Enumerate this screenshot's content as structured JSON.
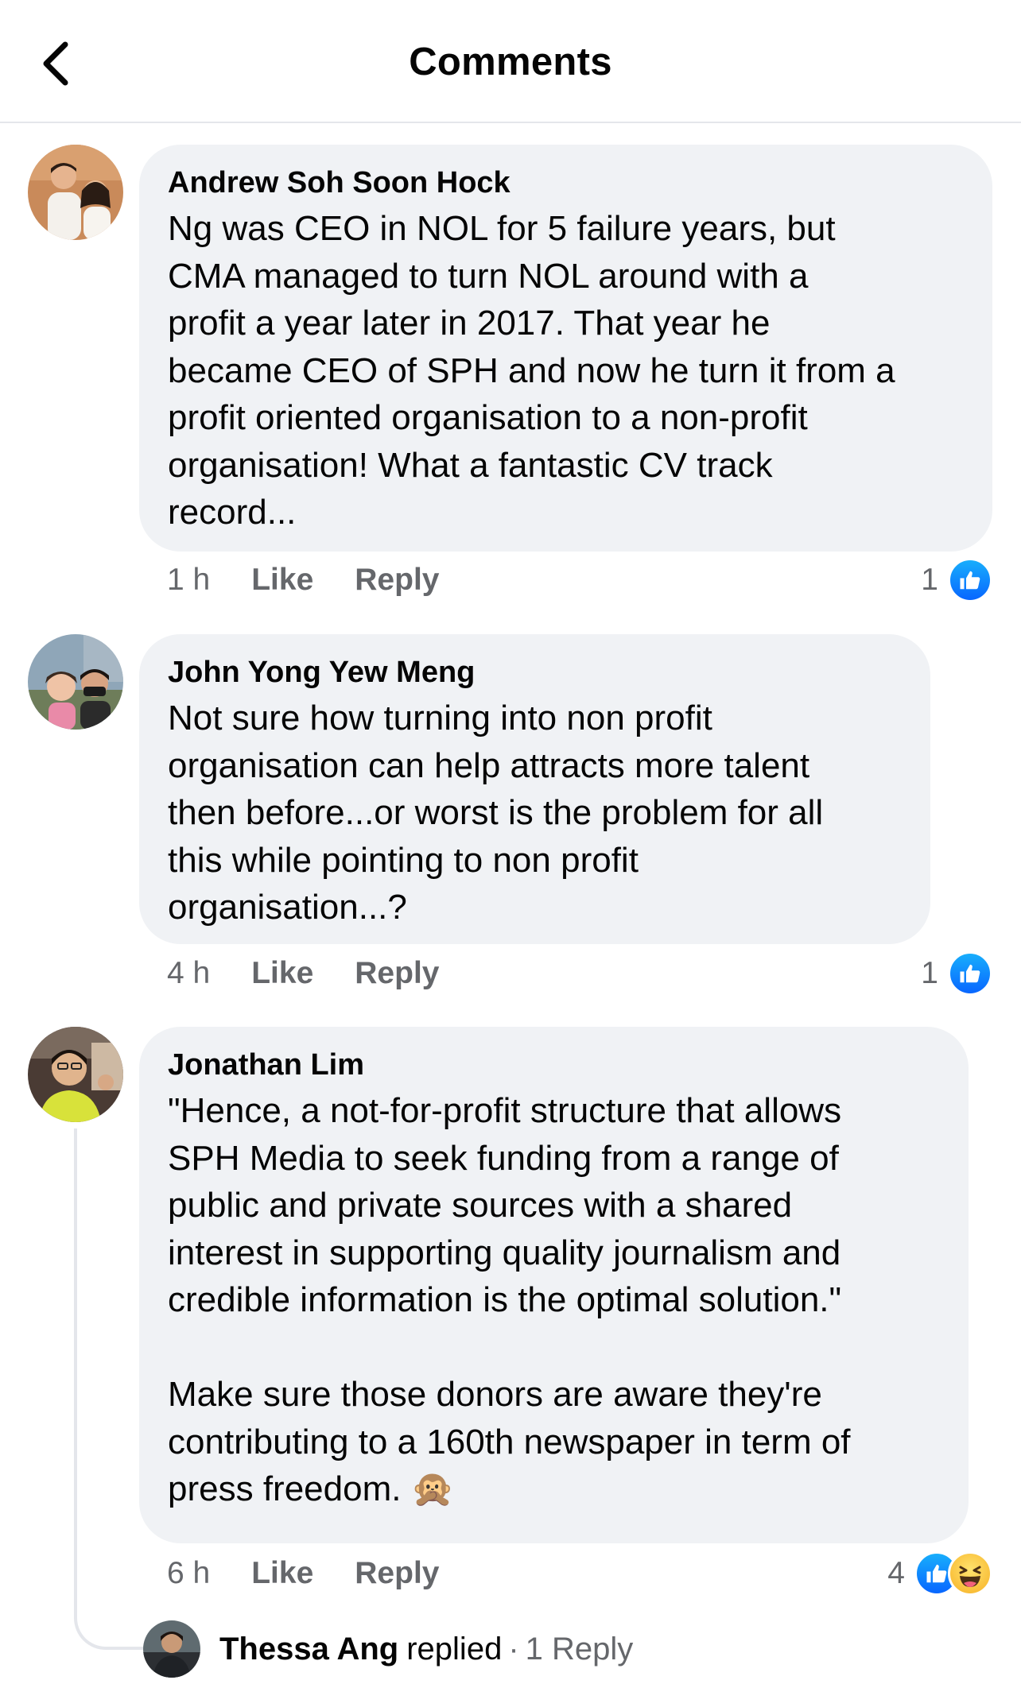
{
  "header": {
    "title": "Comments",
    "back_icon": "chevron-left-icon"
  },
  "comments": [
    {
      "author": "Andrew Soh Soon Hock",
      "text": "Ng was CEO in NOL for 5 failure years, but\nCMA managed to turn NOL around with a\nprofit a year later in 2017. That year he\nbecame CEO of SPH and now he turn it from a\nprofit oriented organisation to a non-profit\norganisation! What a fantastic CV track\nrecord...",
      "time": "1 h",
      "like_label": "Like",
      "reply_label": "Reply",
      "reaction_count": "1",
      "reactions": [
        "like"
      ]
    },
    {
      "author": "John Yong Yew Meng",
      "text": "Not sure how turning into non profit\norganisation can help attracts more talent\nthen before...or worst is the problem for all\nthis while pointing to non profit\norganisation...?",
      "time": "4 h",
      "like_label": "Like",
      "reply_label": "Reply",
      "reaction_count": "1",
      "reactions": [
        "like"
      ]
    },
    {
      "author": "Jonathan Lim",
      "text": "\"Hence, a not-for-profit structure that allows\nSPH Media to seek funding from a range of\npublic and private sources with a shared\ninterest in supporting quality journalism and\ncredible information is the optimal solution.\"\n\nMake sure those donors are aware they're\ncontributing to a 160th newspaper in term of\npress freedom.",
      "emoji": "🙊",
      "time": "6 h",
      "like_label": "Like",
      "reply_label": "Reply",
      "reaction_count": "4",
      "reactions": [
        "like",
        "haha"
      ]
    }
  ],
  "replies_summary": {
    "name": "Thessa Ang",
    "verb": "replied",
    "separator": "·",
    "count_label": "1 Reply"
  },
  "colors": {
    "bubble": "#f0f2f5",
    "meta_text": "#65676b",
    "like_blue": "#0866ff",
    "divider": "#e4e6eb"
  }
}
